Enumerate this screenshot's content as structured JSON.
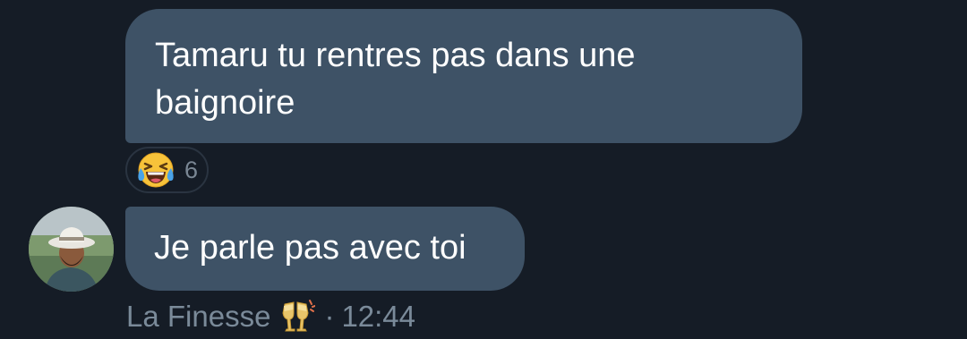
{
  "messages": [
    {
      "text_line1": "Tamaru tu rentres pas dans une",
      "text_line2": "baignoire",
      "reaction": {
        "emoji_icon": "face-with-tears-of-joy-icon",
        "count": "6"
      }
    },
    {
      "text": "Je parle pas avec toi",
      "sender": {
        "name": "La Finesse",
        "name_emoji_icon": "clinking-glasses-icon",
        "separator": "·",
        "time": "12:44"
      }
    }
  ],
  "colors": {
    "background": "#151c26",
    "bubble": "#3e5266",
    "meta_text": "#7a8a99",
    "reaction_border": "#2a3441"
  }
}
